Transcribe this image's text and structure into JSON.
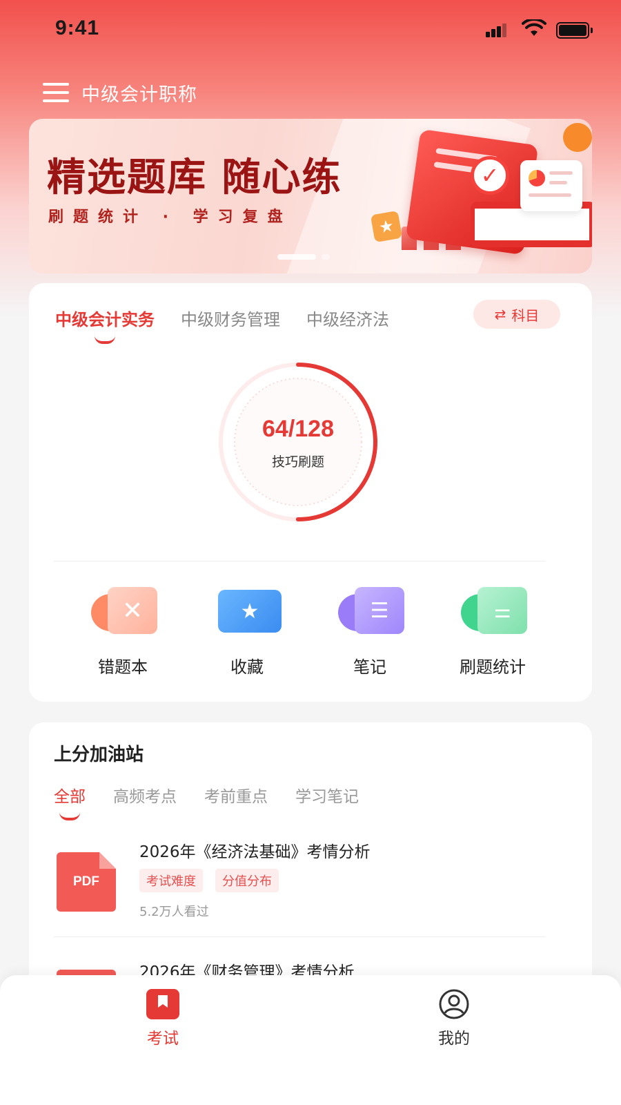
{
  "status_bar": {
    "time": "9:41"
  },
  "header": {
    "title": "中级会计职称"
  },
  "banner": {
    "title": "精选题库 随心练",
    "subtitle": "刷题统计 · 学习复盘"
  },
  "subjects": {
    "tabs": [
      "中级会计实务",
      "中级财务管理",
      "中级经济法"
    ],
    "active_index": 0,
    "switch_label": "科目"
  },
  "progress": {
    "done": 64,
    "total": 128,
    "text": "64/128",
    "label": "技巧刷题"
  },
  "tools": [
    {
      "label": "错题本",
      "icon": "wrong-book-icon",
      "color": "#ff7a5c"
    },
    {
      "label": "收藏",
      "icon": "favorite-folder-icon",
      "color": "#4a9df8"
    },
    {
      "label": "笔记",
      "icon": "notes-icon",
      "color": "#8b6cf6"
    },
    {
      "label": "刷题统计",
      "icon": "stats-sliders-icon",
      "color": "#3fcf8e"
    }
  ],
  "boost": {
    "title": "上分加油站",
    "tabs": [
      "全部",
      "高频考点",
      "考前重点",
      "学习笔记"
    ],
    "active_index": 0,
    "articles": [
      {
        "title": "2026年《经济法基础》考情分析",
        "tags": [
          "考试难度",
          "分值分布"
        ],
        "views": "5.2万人看过",
        "file_type": "PDF"
      },
      {
        "title": "2026年《财务管理》考情分析",
        "file_type": "PDF"
      }
    ]
  },
  "bottom_nav": {
    "items": [
      "考试",
      "我的"
    ],
    "active_index": 0
  },
  "colors": {
    "accent": "#e53935",
    "header_gradient_top": "#f2504c"
  }
}
